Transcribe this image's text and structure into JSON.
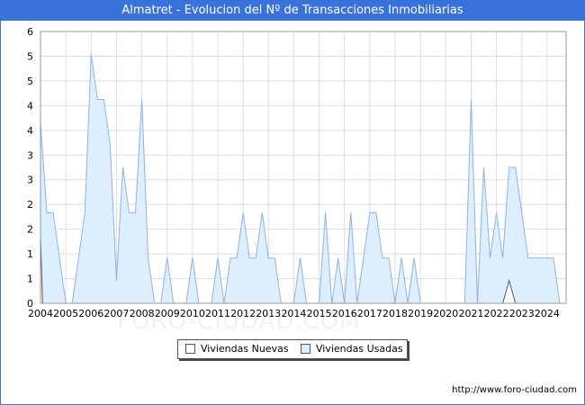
{
  "header": {
    "title": "Almatret - Evolucion del Nº de Transacciones Inmobiliarias"
  },
  "footer": {
    "url": "http://www.foro-ciudad.com"
  },
  "watermark": {
    "text": "FORO-CIUDAD.COM"
  },
  "legend": {
    "items": [
      "Viviendas Nuevas",
      "Viviendas Usadas"
    ]
  },
  "chart_data": {
    "type": "area",
    "title": "Almatret - Evolucion del Nº de Transacciones Inmobiliarias",
    "xlabel": "",
    "ylabel": "",
    "ylim": [
      0,
      6
    ],
    "xlim": [
      2004,
      2024.75
    ],
    "y_ticks": [
      "0",
      "1",
      "1",
      "2",
      "2",
      "3",
      "3",
      "4",
      "4",
      "5",
      "5",
      "6"
    ],
    "x_ticks": [
      "2004",
      "2005",
      "2006",
      "2007",
      "2008",
      "2009",
      "2010",
      "2011",
      "2012",
      "2013",
      "2014",
      "2015",
      "2016",
      "2017",
      "2018",
      "2019",
      "2020",
      "2021",
      "2022",
      "2023",
      "2024"
    ],
    "grid": true,
    "legend_position": "bottom",
    "colors": {
      "nuevas_fill": "#ffffff",
      "nuevas_line": "#555555",
      "usadas_fill": "#ddeeff",
      "usadas_line": "#8eb4dc",
      "grid": "#dddddd",
      "title_bg": "#3a72dc"
    },
    "series": [
      {
        "name": "Viviendas Nuevas",
        "x": [
          2004.0,
          2004.08,
          2004.25,
          2022.25,
          2022.5,
          2022.75
        ],
        "y": [
          1.5,
          0,
          0,
          0,
          0.5,
          0
        ]
      },
      {
        "name": "Viviendas Usadas",
        "x": [
          2004.0,
          2004.25,
          2004.5,
          2005.0,
          2005.25,
          2005.75,
          2006.0,
          2006.25,
          2006.5,
          2006.75,
          2007.0,
          2007.25,
          2007.5,
          2007.75,
          2008.0,
          2008.25,
          2008.5,
          2008.75,
          2009.0,
          2009.25,
          2009.5,
          2009.75,
          2010.0,
          2010.25,
          2010.5,
          2010.75,
          2011.0,
          2011.25,
          2011.5,
          2011.75,
          2012.0,
          2012.25,
          2012.5,
          2012.75,
          2013.0,
          2013.25,
          2013.5,
          2013.75,
          2014.0,
          2014.25,
          2014.5,
          2014.75,
          2015.0,
          2015.25,
          2015.5,
          2015.75,
          2016.0,
          2016.25,
          2016.5,
          2016.75,
          2017.0,
          2017.25,
          2017.5,
          2017.75,
          2018.0,
          2018.25,
          2018.5,
          2018.75,
          2019.0,
          2019.25,
          2019.5,
          2019.75,
          2020.0,
          2020.25,
          2020.5,
          2020.75,
          2021.0,
          2021.25,
          2021.5,
          2021.75,
          2022.0,
          2022.25,
          2022.5,
          2022.75,
          2023.0,
          2023.25,
          2023.5,
          2023.75,
          2024.0,
          2024.25,
          2024.5
        ],
        "y": [
          4,
          2,
          2,
          0,
          0,
          2,
          5.5,
          4.5,
          4.5,
          3.5,
          0.5,
          3,
          2,
          2,
          4.5,
          1,
          0,
          0,
          1,
          0,
          0,
          0,
          1,
          0,
          0,
          0,
          1,
          0,
          1,
          1,
          2,
          1,
          1,
          2,
          1,
          1,
          0,
          0,
          0,
          1,
          0,
          0,
          0,
          2,
          0,
          1,
          0,
          2,
          0,
          1,
          2,
          2,
          1,
          1,
          0,
          1,
          0,
          1,
          0,
          0,
          0,
          0,
          0,
          0,
          0,
          0,
          4.5,
          0,
          3,
          1,
          2,
          1,
          3,
          3,
          2,
          1,
          1,
          1,
          1,
          1,
          0
        ]
      }
    ]
  }
}
